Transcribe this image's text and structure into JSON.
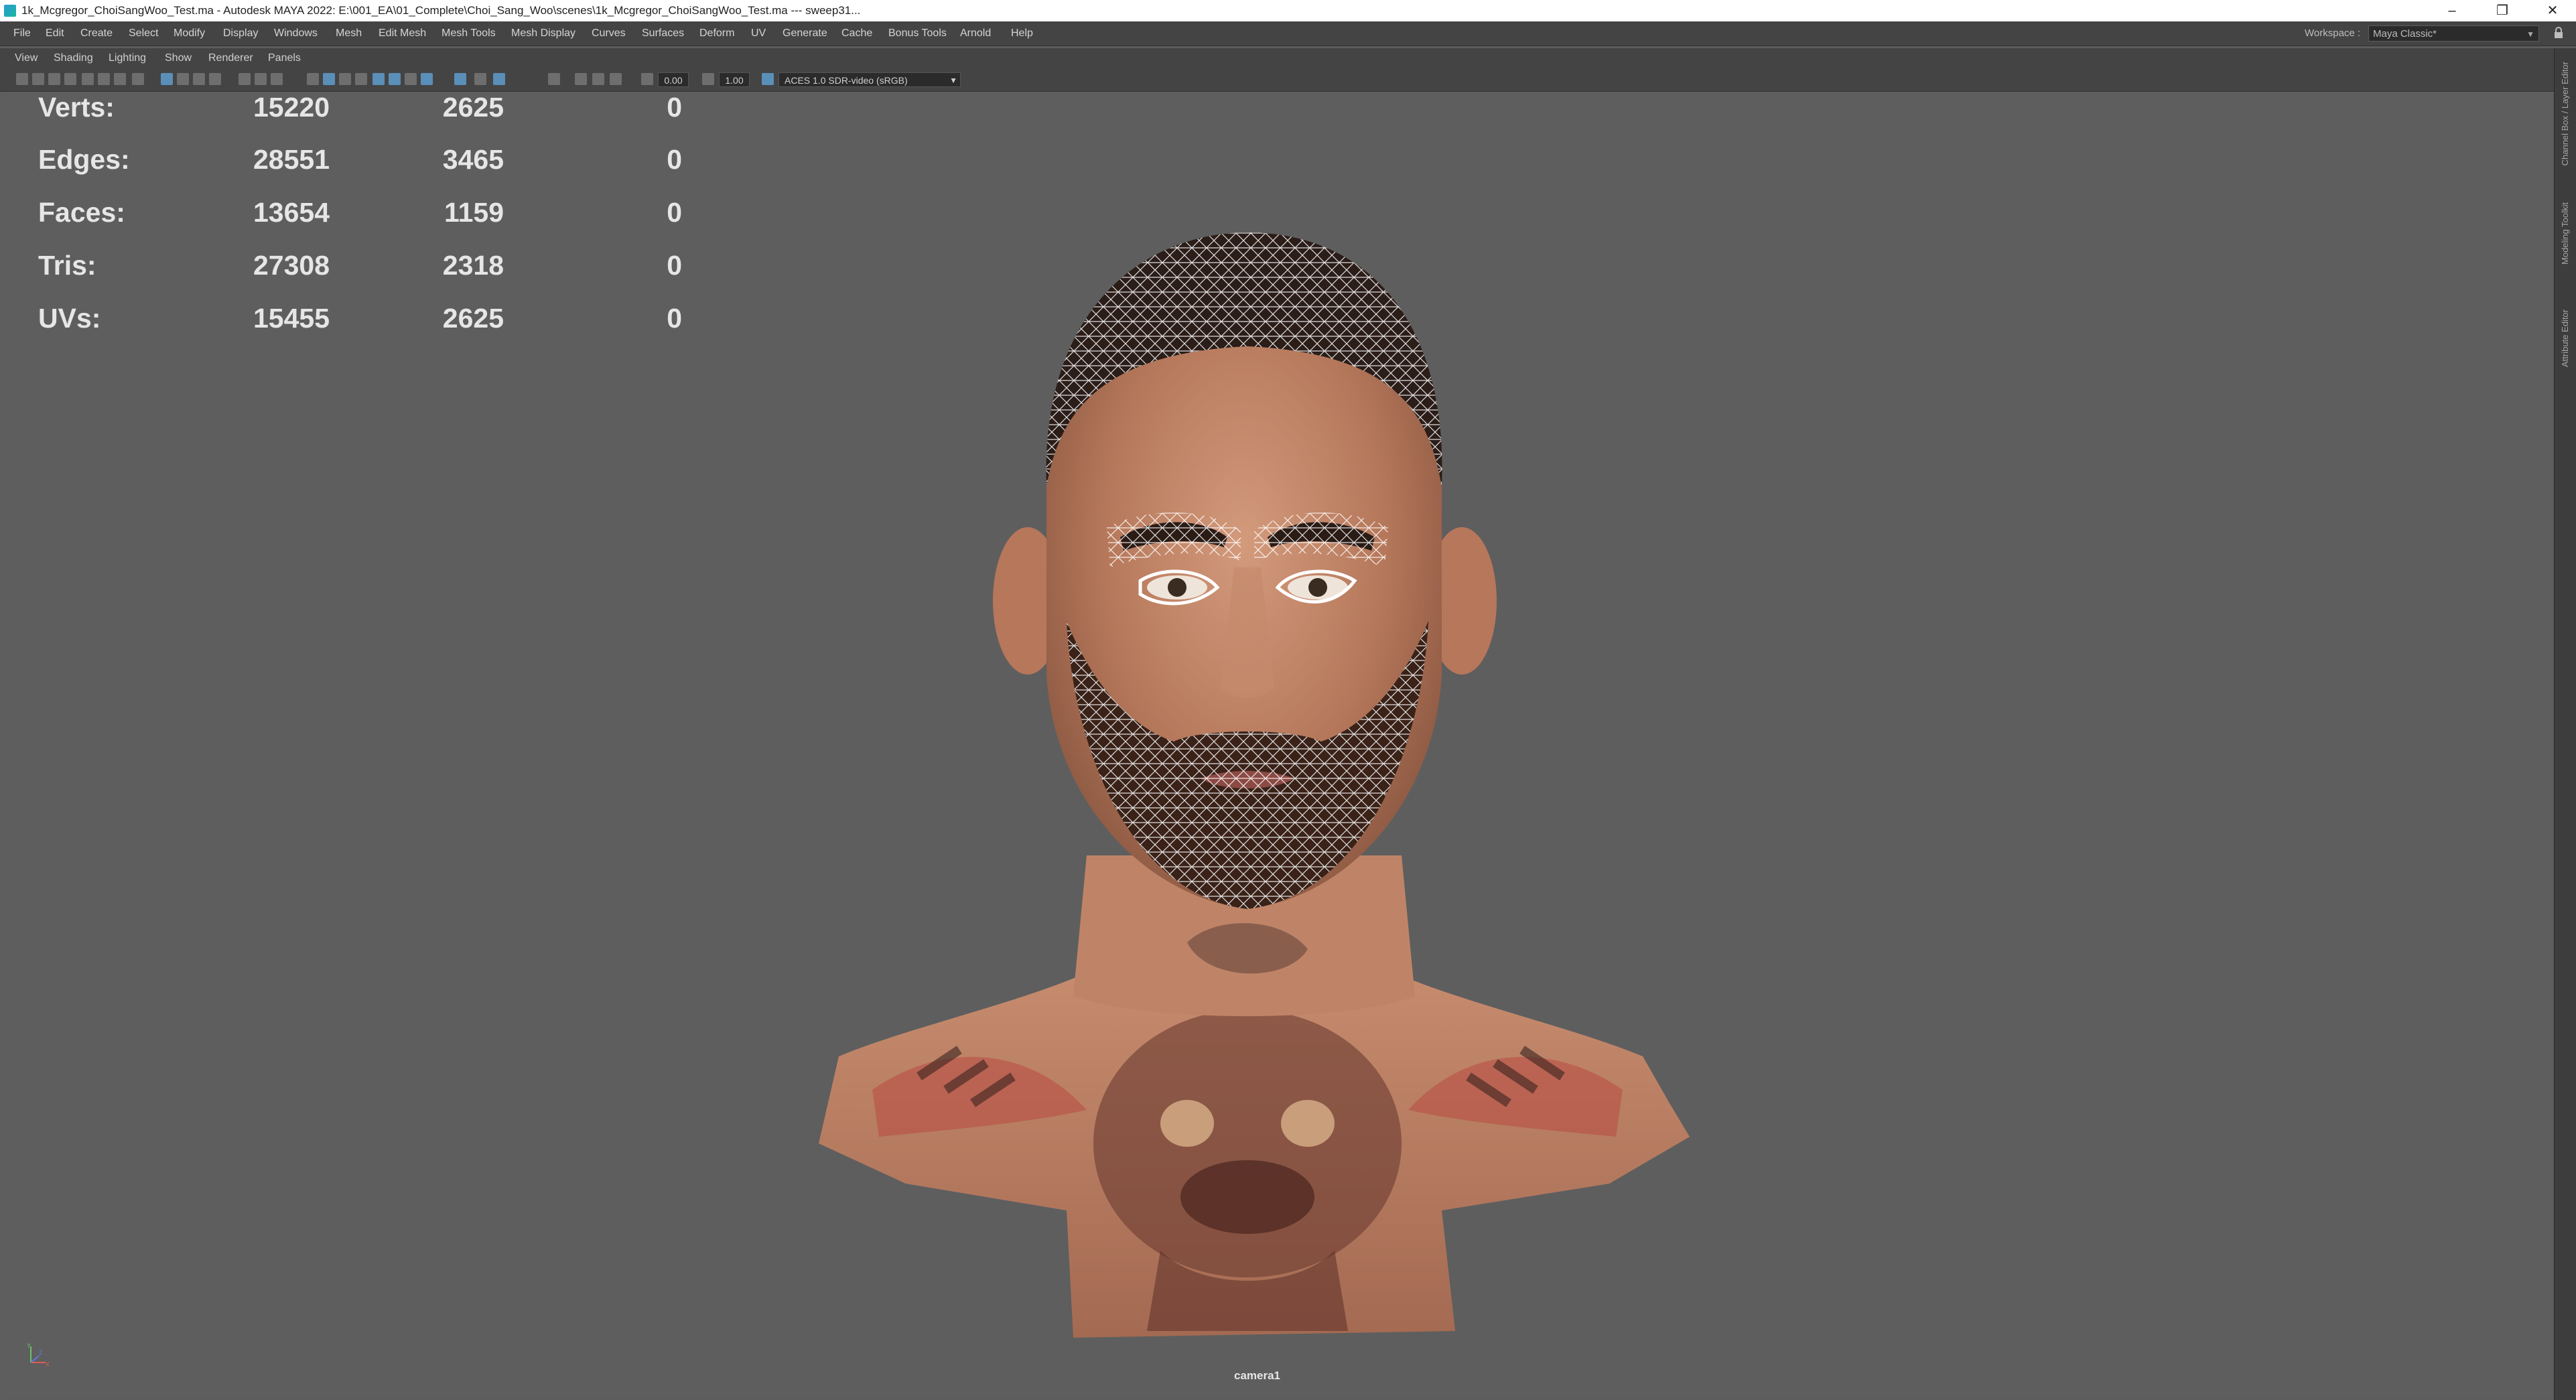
{
  "window": {
    "title": "1k_Mcgregor_ChoiSangWoo_Test.ma - Autodesk MAYA 2022: E:\\001_EA\\01_Complete\\Choi_Sang_Woo\\scenes\\1k_Mcgregor_ChoiSangWoo_Test.ma   ---   sweep31...",
    "minimize": "–",
    "restore": "❐",
    "close": "✕"
  },
  "menubar": {
    "items": [
      "File",
      "Edit",
      "Create",
      "Select",
      "Modify",
      "Display",
      "Windows",
      "Mesh",
      "Edit Mesh",
      "Mesh Tools",
      "Mesh Display",
      "Curves",
      "Surfaces",
      "Deform",
      "UV",
      "Generate",
      "Cache",
      "Bonus Tools",
      "Arnold",
      "Help"
    ],
    "workspace_label": "Workspace :",
    "workspace_value": "Maya Classic*"
  },
  "panel_menu": {
    "items": [
      "View",
      "Shading",
      "Lighting",
      "Show",
      "Renderer",
      "Panels"
    ]
  },
  "panel_toolbar": {
    "exposure": "0.00",
    "gamma": "1.00",
    "color_space": "ACES 1.0 SDR-video (sRGB)"
  },
  "hud": {
    "rows": [
      {
        "label": "Verts:",
        "total": "15220",
        "selected": "2625",
        "component": "0"
      },
      {
        "label": "Edges:",
        "total": "28551",
        "selected": "3465",
        "component": "0"
      },
      {
        "label": "Faces:",
        "total": "13654",
        "selected": "1159",
        "component": "0"
      },
      {
        "label": "Tris:",
        "total": "27308",
        "selected": "2318",
        "component": "0"
      },
      {
        "label": "UVs:",
        "total": "15455",
        "selected": "2625",
        "component": "0"
      }
    ]
  },
  "viewport": {
    "camera": "camera1",
    "axis_x": "X",
    "axis_y": "Y",
    "axis_z": "Z"
  },
  "side_tabs": [
    "Channel Box / Layer Editor",
    "Modeling Toolkit",
    "Attribute Editor"
  ],
  "colors": {
    "viewport_bg": "#5e5e5e",
    "ui_dark": "#444444",
    "accent": "#5a8fb8"
  }
}
